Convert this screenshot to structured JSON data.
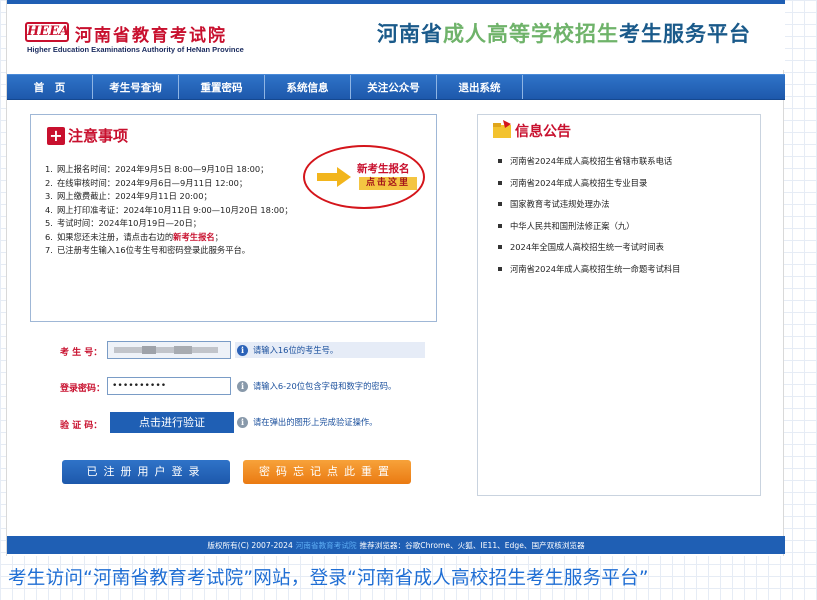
{
  "header": {
    "logo_mark": "HEEA",
    "logo_cn": "河南省教育考试院",
    "logo_en": "Higher Education Examinations Authority of HeNan Province",
    "platform_title_a": "河南省",
    "platform_title_b": "成人高等学校招生",
    "platform_title_c": "考生服务平台"
  },
  "nav": {
    "items": [
      {
        "label": "首　页"
      },
      {
        "label": "考生号查询"
      },
      {
        "label": "重置密码"
      },
      {
        "label": "系统信息"
      },
      {
        "label": "关注公众号"
      },
      {
        "label": "退出系统"
      }
    ]
  },
  "notice": {
    "title": "注意事项",
    "items": [
      {
        "num": "1.",
        "text": "网上报名时间：2024年9月5日 8:00—9月10日 18:00；"
      },
      {
        "num": "2.",
        "text": "在线审核时间：2024年9月6日—9月11日 12:00；"
      },
      {
        "num": "3.",
        "text": "网上缴费截止：2024年9月11日 20:00；"
      },
      {
        "num": "4.",
        "text": "网上打印准考证：2024年10月11日 9:00—10月20日 18:00；"
      },
      {
        "num": "5.",
        "text": "考试时间：2024年10月19日—20日；"
      },
      {
        "num": "6.",
        "text_a": "如果您还未注册，请点击右边的",
        "text_em": "新考生报名",
        "text_b": "；"
      },
      {
        "num": "7.",
        "text": "已注册考生输入16位考生号和密码登录此服务平台。"
      }
    ],
    "register_title": "新考生报名",
    "register_click": "点击这里"
  },
  "announce": {
    "title": "信息公告",
    "items": [
      "河南省2024年成人高校招生省辖市联系电话",
      "河南省2024年成人高校招生专业目录",
      "国家教育考试违规处理办法",
      "中华人民共和国刑法修正案（九）",
      "2024年全国成人高校招生统一考试时间表",
      "河南省2024年成人高校招生统一命题考试科目"
    ]
  },
  "login": {
    "exam_no_label": "考 生 号：",
    "exam_no_hint": "请输入16位的考生号。",
    "password_label": "登录密码：",
    "password_value": "••••••••••",
    "password_hint": "请输入6-20位包含字母和数字的密码。",
    "verify_label": "验 证 码：",
    "verify_button": "点击进行验证",
    "verify_hint": "请在弹出的图形上完成验证操作。",
    "login_button": "已注册用户登录",
    "reset_button": "密码忘记点此重置"
  },
  "footer": {
    "copyright": "版权所有(C) 2007-2024",
    "org": "河南省教育考试院",
    "browsers": "推荐浏览器：谷歌Chrome、火狐、IE11、Edge、国产双核浏览器"
  },
  "caption": "考生访问“河南省教育考试院”网站，登录“河南省成人高校招生考生服务平台”",
  "colors": {
    "brand_blue": "#1f5fb4",
    "brand_red": "#c8102e",
    "accent_orange": "#ea7a12",
    "title_green": "#6fb36a"
  }
}
